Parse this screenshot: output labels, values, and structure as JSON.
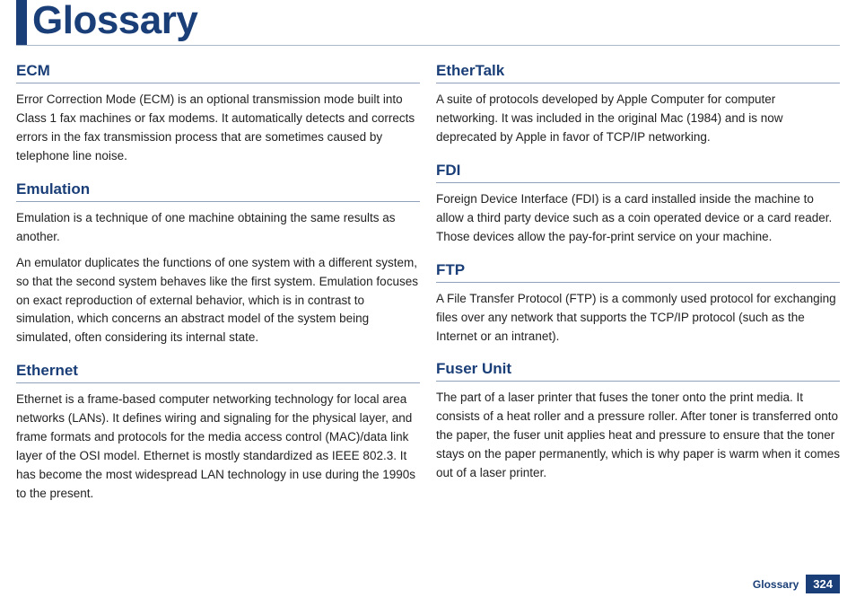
{
  "header": {
    "title": "Glossary"
  },
  "left": {
    "e0": {
      "term": "ECM",
      "p0": "Error Correction Mode (ECM) is an optional transmission mode built into Class 1 fax machines or fax modems. It automatically detects and corrects errors in the fax transmission process that are sometimes caused by telephone line noise."
    },
    "e1": {
      "term": "Emulation",
      "p0": "Emulation is a technique of one machine obtaining the same results as another.",
      "p1": "An emulator duplicates the functions of one system with a different system, so that the second system behaves like the first system. Emulation focuses on exact reproduction of external behavior, which is in contrast to simulation, which concerns an abstract model of the system being simulated, often considering its internal state."
    },
    "e2": {
      "term": "Ethernet",
      "p0": "Ethernet is a frame-based computer networking technology for local area networks (LANs). It defines wiring and signaling for the physical layer, and frame formats and protocols for the media access control (MAC)/data link layer of the OSI model. Ethernet is mostly standardized as IEEE 802.3. It has become the most widespread LAN technology in use during the 1990s to the present."
    }
  },
  "right": {
    "e0": {
      "term": "EtherTalk",
      "p0": "A suite of protocols developed by Apple Computer for computer networking. It was included in the original Mac (1984) and is now deprecated by Apple in favor of TCP/IP networking."
    },
    "e1": {
      "term": "FDI",
      "p0": "Foreign Device Interface (FDI) is a card installed inside the machine to allow a third party device such as a coin operated device or a card reader. Those devices allow the pay-for-print service on your machine."
    },
    "e2": {
      "term": "FTP",
      "p0": "A File Transfer Protocol (FTP) is a commonly used protocol for exchanging files over any network that supports the TCP/IP protocol (such as the Internet or an intranet)."
    },
    "e3": {
      "term": "Fuser Unit",
      "p0": "The part of a laser printer that fuses the toner onto the print media. It consists of a heat roller and a pressure roller. After toner is transferred onto the paper, the fuser unit applies heat and pressure to ensure that the toner stays on the paper permanently, which is why paper is warm when it comes out of a laser printer."
    }
  },
  "footer": {
    "label": "Glossary",
    "page": "324"
  }
}
